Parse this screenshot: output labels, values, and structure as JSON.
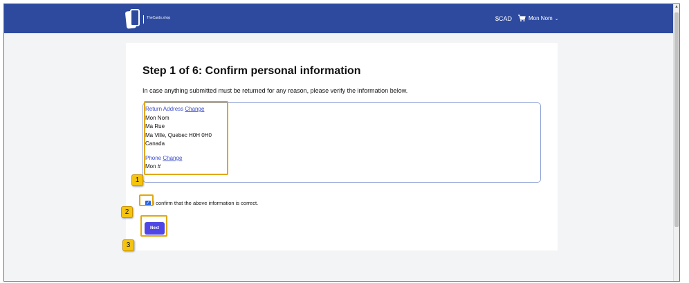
{
  "header": {
    "brand": "TheCards.shop",
    "currency": "$CAD",
    "user_name": "Mon Nom",
    "chevron": "⌄"
  },
  "main": {
    "title": "Step 1 of 6: Confirm personal information",
    "intro": "In case anything submitted must be returned for any reason, please verify the information below.",
    "address_label": "Return Address",
    "change_label": "Change",
    "address_lines": [
      "Mon Nom",
      "Ma Rue",
      "Ma Ville, Quebec H0H 0H0",
      "Canada"
    ],
    "phone_label": "Phone",
    "phone_value": "Mon #",
    "confirm_text": "I confirm that the above information is correct.",
    "confirm_checked": true,
    "next_label": "Next"
  },
  "annotations": {
    "markers": [
      "1",
      "2",
      "3"
    ],
    "highlight_color": "#e0a80d"
  },
  "colors": {
    "header_bg": "#2e4a9e",
    "accent": "#4f46e5",
    "link": "#3b4cca"
  },
  "icons": [
    "logo-cards-icon",
    "cart-icon",
    "chevron-down-icon",
    "checkmark-icon",
    "scroll-up-arrow-icon"
  ]
}
